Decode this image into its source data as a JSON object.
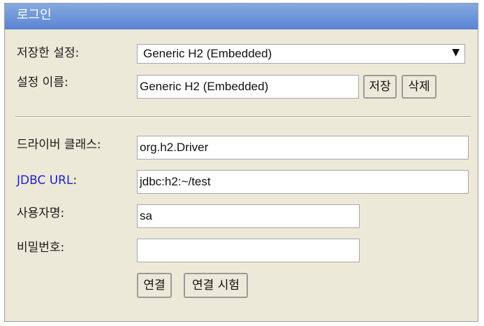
{
  "title": "로그인",
  "saved_settings": {
    "label": "저장한 설정:",
    "selected": "Generic H2 (Embedded)"
  },
  "setting_name": {
    "label": "설정 이름:",
    "value": "Generic H2 (Embedded)",
    "save_label": "저장",
    "delete_label": "삭제"
  },
  "driver_class": {
    "label": "드라이버 클래스:",
    "value": "org.h2.Driver"
  },
  "jdbc_url": {
    "link_text": "JDBC URL",
    "suffix": ":",
    "value": "jdbc:h2:~/test"
  },
  "username": {
    "label": "사용자명:",
    "value": "sa"
  },
  "password": {
    "label": "비밀번호:",
    "value": ""
  },
  "buttons": {
    "connect": "연결",
    "test_connection": "연결 시험"
  },
  "icons": {
    "dropdown": "dropdown-arrow-icon"
  }
}
